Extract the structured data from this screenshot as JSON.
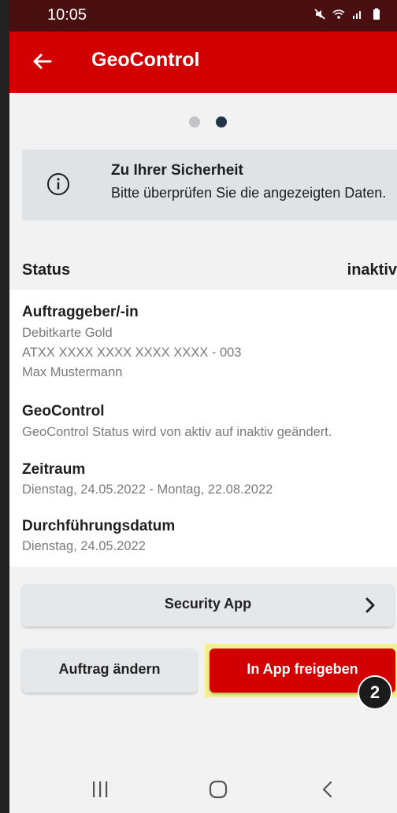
{
  "status_bar": {
    "time": "10:05",
    "icons": [
      "mute-icon",
      "wifi-icon",
      "signal-icon",
      "battery-icon"
    ]
  },
  "app_bar": {
    "title": "GeoControl",
    "back_icon": "arrow-left-icon"
  },
  "pager": {
    "count": 2,
    "active_index": 1
  },
  "info_box": {
    "title": "Zu Ihrer Sicherheit",
    "text": "Bitte überprüfen Sie die angezeigten Daten."
  },
  "status": {
    "label": "Status",
    "value": "inaktiv"
  },
  "details": {
    "auftraggeber": {
      "title": "Auftraggeber/-in",
      "lines": [
        "Debitkarte Gold",
        "ATXX XXXX XXXX XXXX XXXX - 003",
        "Max Mustermann"
      ]
    },
    "geocontrol": {
      "title": "GeoControl",
      "text": "GeoControl Status wird von aktiv auf inaktiv geändert."
    },
    "zeitraum": {
      "title": "Zeitraum",
      "text": "Dienstag, 24.05.2022 - Montag, 22.08.2022"
    },
    "durchfuehrung": {
      "title": "Durchführungsdatum",
      "text": "Dienstag, 24.05.2022"
    }
  },
  "buttons": {
    "security_app": "Security App",
    "edit_order": "Auftrag ändern",
    "release_in_app": "In App freigeben"
  },
  "step_badge": "2",
  "nav_bar": [
    "recent-apps-icon",
    "home-icon",
    "back-icon"
  ],
  "colors": {
    "brand_red": "#d20000",
    "status_bar": "#4a0f10",
    "dark_text": "#1e1e1e",
    "highlight": "#f3f28a"
  }
}
